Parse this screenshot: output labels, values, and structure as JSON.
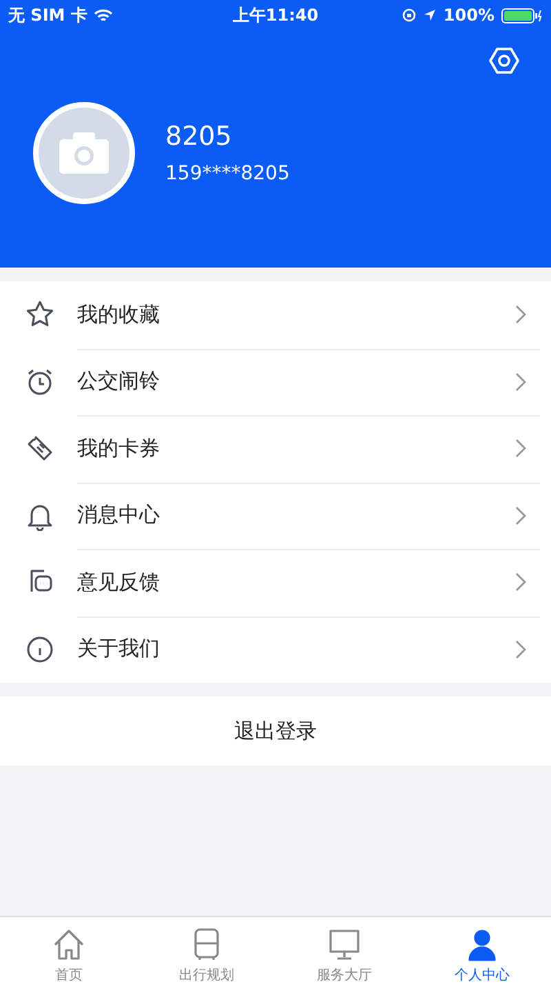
{
  "status_bar": {
    "carrier": "无 SIM 卡",
    "time": "上午11:40",
    "battery": "100%"
  },
  "profile": {
    "name": "8205",
    "phone": "159****8205"
  },
  "menu": [
    {
      "label": "我的收藏"
    },
    {
      "label": "公交闹铃"
    },
    {
      "label": "我的卡券"
    },
    {
      "label": "消息中心"
    },
    {
      "label": "意见反馈"
    },
    {
      "label": "关于我们"
    }
  ],
  "logout": "退出登录",
  "tabs": [
    {
      "label": "首页",
      "selected": false
    },
    {
      "label": "出行规划",
      "selected": false
    },
    {
      "label": "服务大厅",
      "selected": false
    },
    {
      "label": "个人中心",
      "selected": true
    }
  ]
}
